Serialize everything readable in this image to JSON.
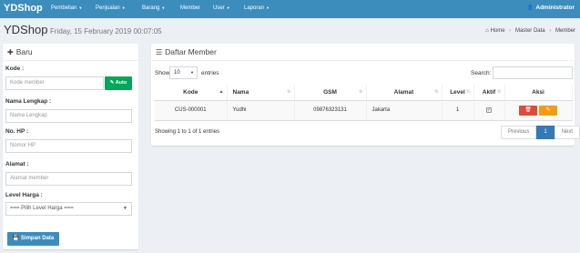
{
  "navbar": {
    "brand": "YDShop",
    "items": [
      {
        "label": "Pembelian",
        "dropdown": true
      },
      {
        "label": "Penjualan",
        "dropdown": true
      },
      {
        "label": "Barang",
        "dropdown": true
      },
      {
        "label": "Member",
        "dropdown": false
      },
      {
        "label": "User",
        "dropdown": true
      },
      {
        "label": "Laporan",
        "dropdown": true
      }
    ],
    "user": "Administrator"
  },
  "header": {
    "title": "YDShop",
    "date": "Friday, 15 February 2019 00:07:05",
    "breadcrumb": [
      "Home",
      "Master Data",
      "Member"
    ]
  },
  "form": {
    "title": "Baru",
    "kode_label": "Kode :",
    "kode_placeholder": "Kode member",
    "auto_button": "Auto",
    "nama_label": "Nama Lengkap :",
    "nama_placeholder": "Nama Lengkap",
    "hp_label": "No. HP :",
    "hp_placeholder": "Nomor HP",
    "alamat_label": "Alamat :",
    "alamat_placeholder": "Alamat member",
    "level_label": "Level Harga :",
    "level_selected": "=== Pilih Level Harga ===",
    "save_button": "Simpan Data"
  },
  "list": {
    "title": "Daftar Member",
    "show_label": "Show",
    "entries_value": "10",
    "entries_label": "entries",
    "search_label": "Search:",
    "columns": [
      "Kode",
      "Nama",
      "GSM",
      "Alamat",
      "Level",
      "Aktif",
      "Aksi"
    ],
    "rows": [
      {
        "kode": "CUS-000001",
        "nama": "Yudhi",
        "gsm": "09876323131",
        "alamat": "Jakarta",
        "level": "1",
        "aktif": true
      }
    ],
    "info": "Showing 1 to 1 of 1 entries",
    "pagination": {
      "previous": "Previous",
      "current": "1",
      "next": "Next"
    }
  },
  "colors": {
    "navbar": "#3c8dbc",
    "auto_button": "#00a65a",
    "delete_button": "#dd4b39",
    "edit_button": "#f39c12",
    "page_active": "#337ab7"
  },
  "icons": {
    "plus": "plus-icon",
    "list": "list-icon",
    "home": "home-icon",
    "user": "user-icon",
    "magic": "magic-wand-icon",
    "save": "save-icon",
    "trash": "trash-icon",
    "edit": "edit-icon"
  }
}
